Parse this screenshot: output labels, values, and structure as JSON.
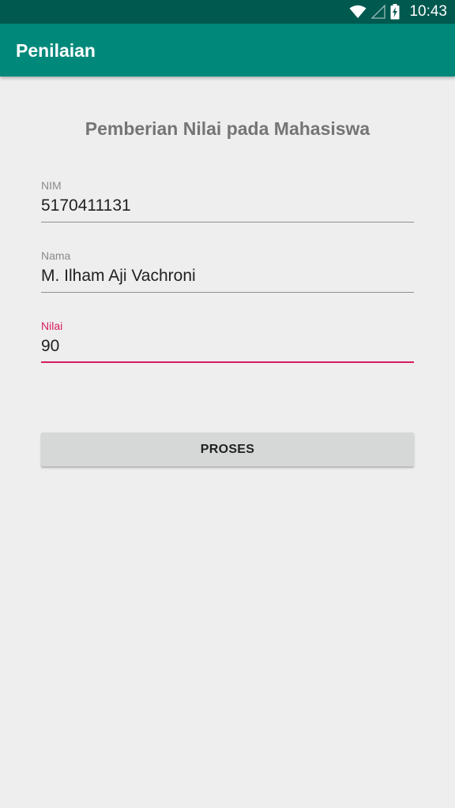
{
  "status_bar": {
    "time": "10:43",
    "icons": [
      "wifi-icon",
      "signal-icon",
      "battery-charging-icon"
    ]
  },
  "app_bar": {
    "title": "Penilaian",
    "color": "#00897b",
    "status_color": "#00594f"
  },
  "form": {
    "heading": "Pemberian Nilai pada Mahasiswa",
    "nim": {
      "label": "NIM",
      "value": "5170411131"
    },
    "nama": {
      "label": "Nama",
      "value": "M. Ilham Aji Vachroni"
    },
    "nilai": {
      "label": "Nilai",
      "value": "90"
    },
    "accent_color": "#d81b60",
    "submit_label": "PROSES"
  }
}
